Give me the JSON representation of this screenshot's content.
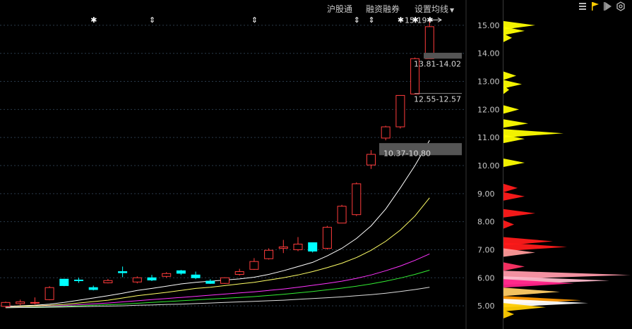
{
  "toolbar": {
    "items": [
      {
        "label": "沪股通"
      },
      {
        "label": "融资融券"
      },
      {
        "label": "设置均线"
      }
    ]
  },
  "right_tools": [
    "list-icon",
    "flag-icon",
    "play-icon",
    "settings-icon"
  ],
  "chart_data": {
    "type": "candlestick",
    "price_axis": {
      "ticks": [
        "15.00",
        "14.00",
        "13.00",
        "12.00",
        "11.00",
        "10.00",
        "9.00",
        "8.00",
        "7.00",
        "6.00",
        "5.00"
      ],
      "ylim": [
        4.4,
        15.7
      ]
    },
    "labels": {
      "high_marker": "15.19",
      "zone_top": "13.81-14.02",
      "zone_mid": "12.55-12.57",
      "zone_low": "10.37-10.80"
    },
    "event_markers": [
      {
        "index": 6,
        "symbol": "✱"
      },
      {
        "index": 10,
        "symbol": "⇕"
      },
      {
        "index": 17,
        "symbol": "⇕"
      },
      {
        "index": 24,
        "symbol": "⇕"
      },
      {
        "index": 25,
        "symbol": "⇕"
      },
      {
        "index": 27,
        "symbol": "✱"
      },
      {
        "index": 28,
        "symbol": "✱"
      },
      {
        "index": 29,
        "symbol": "✱"
      }
    ],
    "candles": [
      {
        "o": 4.98,
        "h": 5.15,
        "l": 4.92,
        "c": 5.12
      },
      {
        "o": 5.08,
        "h": 5.22,
        "l": 5.02,
        "c": 5.14
      },
      {
        "o": 5.1,
        "h": 5.3,
        "l": 5.05,
        "c": 5.12
      },
      {
        "o": 5.22,
        "h": 5.7,
        "l": 5.2,
        "c": 5.65
      },
      {
        "o": 5.95,
        "h": 5.95,
        "l": 5.7,
        "c": 5.72
      },
      {
        "o": 5.92,
        "h": 6.0,
        "l": 5.82,
        "c": 5.9
      },
      {
        "o": 5.65,
        "h": 5.72,
        "l": 5.55,
        "c": 5.58
      },
      {
        "o": 5.82,
        "h": 5.96,
        "l": 5.8,
        "c": 5.9
      },
      {
        "o": 6.22,
        "h": 6.4,
        "l": 6.02,
        "c": 6.18
      },
      {
        "o": 5.85,
        "h": 6.05,
        "l": 5.8,
        "c": 6.0
      },
      {
        "o": 6.0,
        "h": 6.1,
        "l": 5.88,
        "c": 5.92
      },
      {
        "o": 6.05,
        "h": 6.2,
        "l": 6.0,
        "c": 6.15
      },
      {
        "o": 6.25,
        "h": 6.28,
        "l": 6.1,
        "c": 6.16
      },
      {
        "o": 6.1,
        "h": 6.22,
        "l": 5.95,
        "c": 6.0
      },
      {
        "o": 5.88,
        "h": 5.95,
        "l": 5.78,
        "c": 5.8
      },
      {
        "o": 5.8,
        "h": 6.02,
        "l": 5.78,
        "c": 6.0
      },
      {
        "o": 6.12,
        "h": 6.32,
        "l": 6.08,
        "c": 6.22
      },
      {
        "o": 6.3,
        "h": 6.7,
        "l": 6.28,
        "c": 6.58
      },
      {
        "o": 6.68,
        "h": 7.05,
        "l": 6.65,
        "c": 6.98
      },
      {
        "o": 7.05,
        "h": 7.35,
        "l": 6.88,
        "c": 7.1
      },
      {
        "o": 7.0,
        "h": 7.45,
        "l": 6.95,
        "c": 7.2
      },
      {
        "o": 7.25,
        "h": 7.25,
        "l": 6.9,
        "c": 6.95
      },
      {
        "o": 7.05,
        "h": 7.85,
        "l": 7.0,
        "c": 7.8
      },
      {
        "o": 7.95,
        "h": 8.6,
        "l": 7.95,
        "c": 8.55
      },
      {
        "o": 8.25,
        "h": 9.4,
        "l": 8.2,
        "c": 9.35
      },
      {
        "o": 10.02,
        "h": 10.55,
        "l": 9.88,
        "c": 10.4
      },
      {
        "o": 10.98,
        "h": 11.42,
        "l": 10.9,
        "c": 11.38
      },
      {
        "o": 11.38,
        "h": 12.48,
        "l": 11.32,
        "c": 12.5
      },
      {
        "o": 12.55,
        "h": 13.85,
        "l": 12.55,
        "c": 13.81
      },
      {
        "o": 13.81,
        "h": 15.19,
        "l": 13.81,
        "c": 14.95
      }
    ],
    "moving_averages": [
      {
        "color": "#ffffff",
        "values": [
          4.98,
          5.0,
          5.02,
          5.06,
          5.12,
          5.2,
          5.28,
          5.36,
          5.45,
          5.55,
          5.62,
          5.7,
          5.78,
          5.84,
          5.88,
          5.92,
          5.96,
          6.02,
          6.12,
          6.25,
          6.4,
          6.55,
          6.78,
          7.05,
          7.4,
          7.85,
          8.45,
          9.2,
          10.0,
          10.9
        ]
      },
      {
        "color": "#ffff66",
        "values": [
          4.96,
          4.98,
          5.0,
          5.02,
          5.05,
          5.1,
          5.15,
          5.2,
          5.28,
          5.36,
          5.42,
          5.48,
          5.55,
          5.62,
          5.66,
          5.72,
          5.78,
          5.84,
          5.92,
          6.0,
          6.1,
          6.22,
          6.36,
          6.52,
          6.72,
          6.98,
          7.3,
          7.7,
          8.2,
          8.85
        ]
      },
      {
        "color": "#ff33ff",
        "values": [
          4.95,
          4.96,
          4.97,
          4.99,
          5.01,
          5.04,
          5.07,
          5.1,
          5.14,
          5.18,
          5.22,
          5.26,
          5.3,
          5.34,
          5.38,
          5.42,
          5.46,
          5.5,
          5.55,
          5.6,
          5.66,
          5.73,
          5.8,
          5.88,
          5.98,
          6.1,
          6.25,
          6.42,
          6.62,
          6.85
        ]
      },
      {
        "color": "#33ee33",
        "values": [
          4.94,
          4.95,
          4.96,
          4.97,
          4.98,
          5.0,
          5.02,
          5.04,
          5.06,
          5.09,
          5.12,
          5.15,
          5.18,
          5.21,
          5.24,
          5.27,
          5.3,
          5.33,
          5.37,
          5.41,
          5.46,
          5.51,
          5.57,
          5.63,
          5.7,
          5.78,
          5.88,
          5.99,
          6.12,
          6.27
        ]
      },
      {
        "color": "#dddddd",
        "values": [
          4.93,
          4.94,
          4.94,
          4.95,
          4.96,
          4.97,
          4.98,
          4.99,
          5.0,
          5.02,
          5.03,
          5.05,
          5.06,
          5.08,
          5.1,
          5.12,
          5.14,
          5.16,
          5.18,
          5.2,
          5.23,
          5.26,
          5.29,
          5.32,
          5.36,
          5.4,
          5.45,
          5.51,
          5.58,
          5.66
        ]
      }
    ],
    "volume_profile": [
      {
        "price": 15.0,
        "w": 45,
        "color": "#ffff00"
      },
      {
        "price": 14.8,
        "w": 30,
        "color": "#ffff00"
      },
      {
        "price": 14.55,
        "w": 12,
        "color": "#ffff00"
      },
      {
        "price": 13.2,
        "w": 18,
        "color": "#ffff00"
      },
      {
        "price": 12.9,
        "w": 26,
        "color": "#ffff00"
      },
      {
        "price": 12.7,
        "w": 8,
        "color": "#ffff00"
      },
      {
        "price": 12.0,
        "w": 22,
        "color": "#ffff00"
      },
      {
        "price": 11.5,
        "w": 35,
        "color": "#ffff00"
      },
      {
        "price": 11.15,
        "w": 85,
        "color": "#ffff00"
      },
      {
        "price": 10.95,
        "w": 30,
        "color": "#ffff00"
      },
      {
        "price": 10.1,
        "w": 30,
        "color": "#ffff00"
      },
      {
        "price": 9.2,
        "w": 20,
        "color": "#ff1a1a"
      },
      {
        "price": 8.9,
        "w": 30,
        "color": "#ff1a1a"
      },
      {
        "price": 8.3,
        "w": 45,
        "color": "#ff1a1a"
      },
      {
        "price": 7.9,
        "w": 15,
        "color": "#ff1a1a"
      },
      {
        "price": 7.3,
        "w": 70,
        "color": "#ff1a1a"
      },
      {
        "price": 7.1,
        "w": 90,
        "color": "#ff1a1a"
      },
      {
        "price": 6.9,
        "w": 45,
        "color": "#ff9999"
      },
      {
        "price": 6.4,
        "w": 30,
        "color": "#ff3366"
      },
      {
        "price": 6.1,
        "w": 180,
        "color": "#ff99aa"
      },
      {
        "price": 5.9,
        "w": 150,
        "color": "#ffbbcc"
      },
      {
        "price": 5.8,
        "w": 100,
        "color": "#ff2288"
      },
      {
        "price": 5.5,
        "w": 80,
        "color": "#ffcc66"
      },
      {
        "price": 5.2,
        "w": 110,
        "color": "#ff9900"
      },
      {
        "price": 5.1,
        "w": 120,
        "color": "#ffffff"
      },
      {
        "price": 4.95,
        "w": 60,
        "color": "#ffcc00"
      },
      {
        "price": 4.7,
        "w": 15,
        "color": "#ffcc00"
      }
    ]
  }
}
